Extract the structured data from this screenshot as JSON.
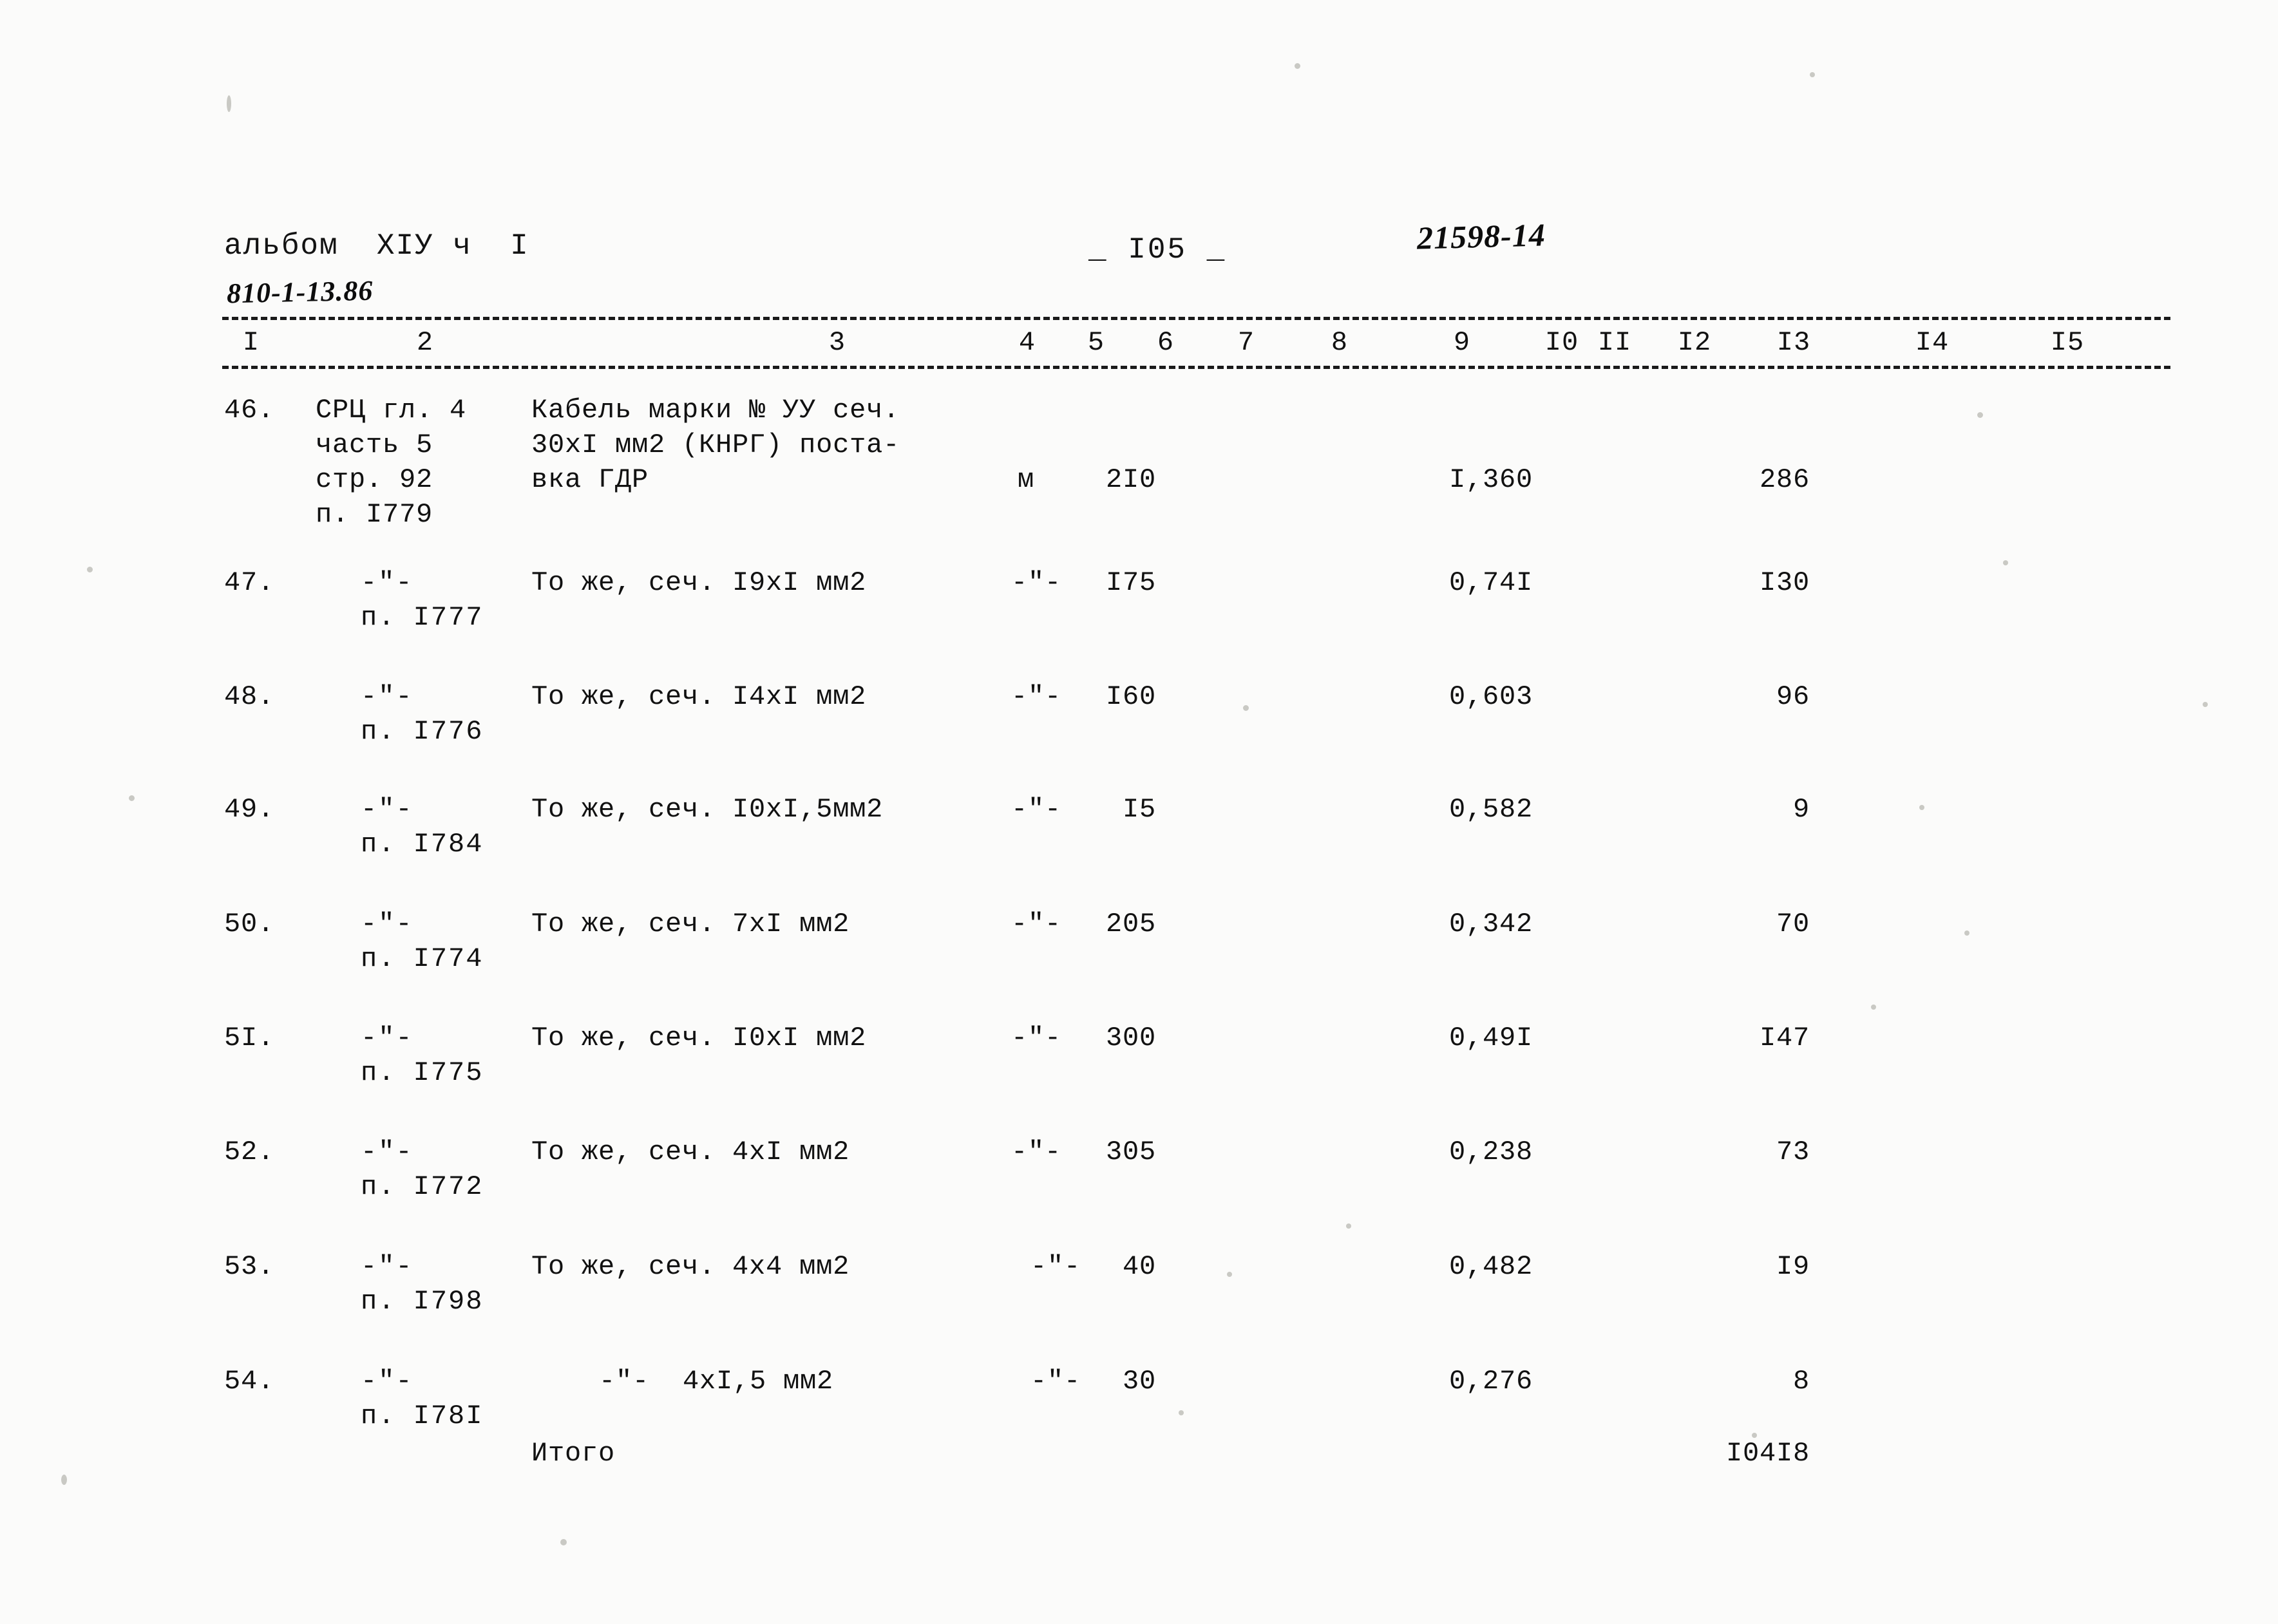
{
  "header": {
    "album_label": "альбом  XIУ ч  I",
    "doc_code_hand": "810-1-13.86",
    "page_number": "_ I05 _",
    "stamp_hand": "21598-14"
  },
  "table": {
    "column_numbers": [
      "I",
      "2",
      "3",
      "4",
      "5",
      "6",
      "7",
      "8",
      "9",
      "I0",
      "II",
      "I2",
      "I3",
      "I4",
      "I5"
    ],
    "rows": [
      {
        "num": "46.",
        "ref_lines": [
          "СРЦ гл. 4",
          "часть 5",
          "стр. 92",
          "п. I779"
        ],
        "desc_lines": [
          "Кабель марки № УУ сеч.",
          "30хI мм2 (КНРГ) поста-",
          "вка ГДР"
        ],
        "unit": "м",
        "qty": "2I0",
        "value": "I,360",
        "total": "286"
      },
      {
        "num": "47.",
        "ref_lines": [
          "-\"-",
          "п. I777"
        ],
        "desc_lines": [
          "То же, сеч. I9хI мм2"
        ],
        "unit": "-\"-",
        "qty": "I75",
        "value": "0,74I",
        "total": "I30"
      },
      {
        "num": "48.",
        "ref_lines": [
          "-\"-",
          "п. I776"
        ],
        "desc_lines": [
          "То же, сеч. I4хI мм2"
        ],
        "unit": "-\"-",
        "qty": "I60",
        "value": "0,603",
        "total": "96"
      },
      {
        "num": "49.",
        "ref_lines": [
          "-\"-",
          "п. I784"
        ],
        "desc_lines": [
          "То же, сеч. I0хI,5мм2"
        ],
        "unit": "-\"-",
        "qty": "I5",
        "value": "0,582",
        "total": "9"
      },
      {
        "num": "50.",
        "ref_lines": [
          "-\"-",
          "п. I774"
        ],
        "desc_lines": [
          "То же, сеч. 7хI мм2"
        ],
        "unit": "-\"-",
        "qty": "205",
        "value": "0,342",
        "total": "70"
      },
      {
        "num": "5I.",
        "ref_lines": [
          "-\"-",
          "п. I775"
        ],
        "desc_lines": [
          "То же, сеч. I0хI мм2"
        ],
        "unit": "-\"-",
        "qty": "300",
        "value": "0,49I",
        "total": "I47"
      },
      {
        "num": "52.",
        "ref_lines": [
          "-\"-",
          "п. I772"
        ],
        "desc_lines": [
          "То же, сеч. 4хI мм2"
        ],
        "unit": "-\"-",
        "qty": "305",
        "value": "0,238",
        "total": "73"
      },
      {
        "num": "53.",
        "ref_lines": [
          "-\"-",
          "п. I798"
        ],
        "desc_lines": [
          "То же, сеч. 4х4 мм2"
        ],
        "unit": "-\"-",
        "qty": "40",
        "value": "0,482",
        "total": "I9"
      },
      {
        "num": "54.",
        "ref_lines": [
          "-\"-",
          "п. I78I"
        ],
        "desc_lines": [
          "-\"-  4хI,5 мм2"
        ],
        "unit": "-\"-",
        "qty": "30",
        "value": "0,276",
        "total": "8"
      }
    ],
    "footer": {
      "label": "Итого",
      "total": "I04I8"
    }
  }
}
